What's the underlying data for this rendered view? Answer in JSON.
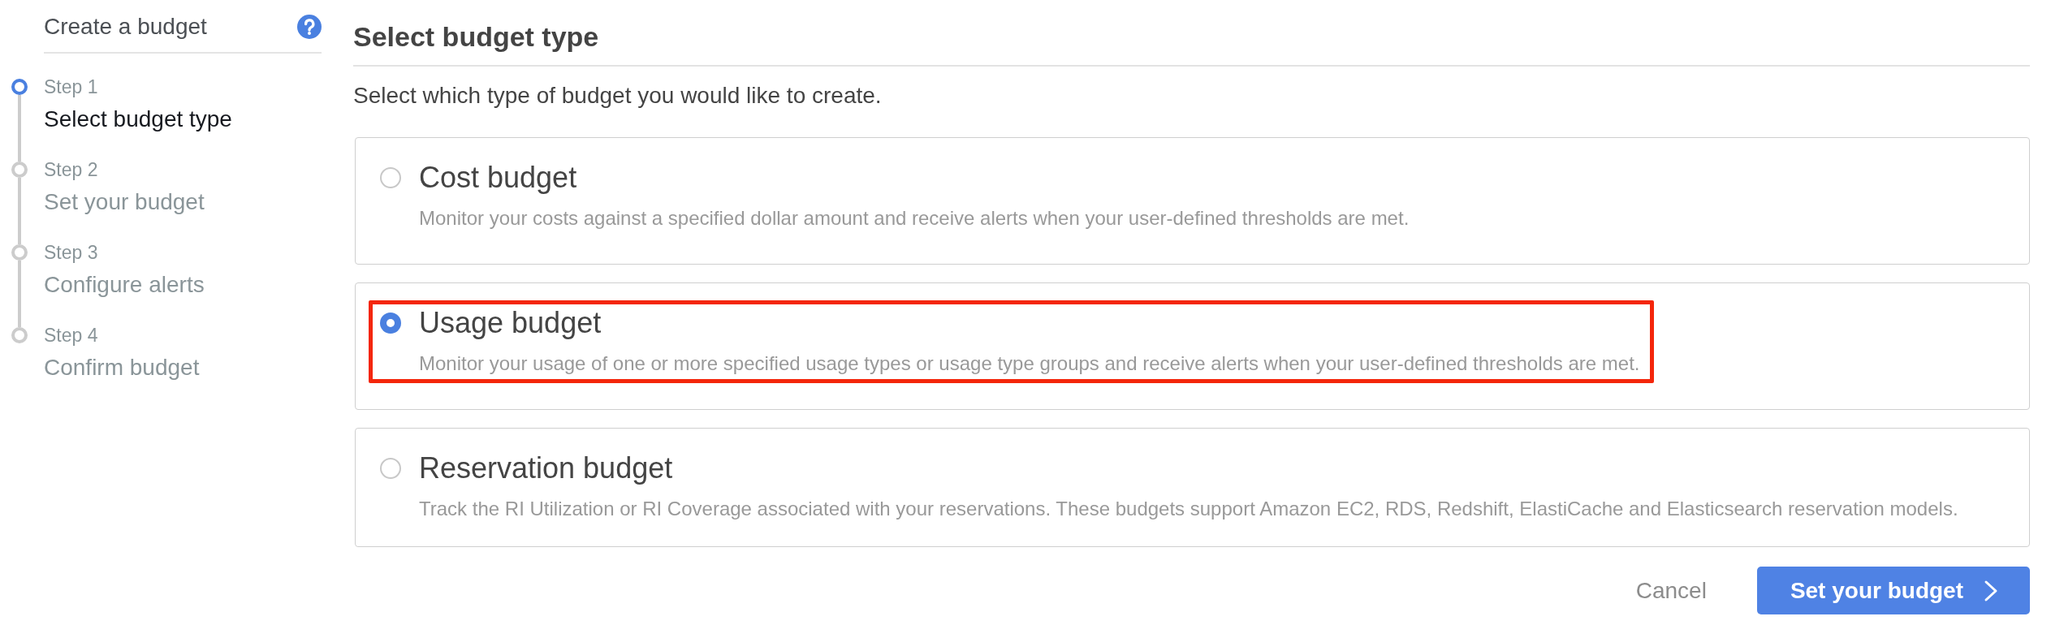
{
  "sidebar": {
    "title": "Create a budget",
    "steps": [
      {
        "label": "Step 1",
        "title": "Select budget type",
        "selected": true
      },
      {
        "label": "Step 2",
        "title": "Set your budget",
        "selected": false
      },
      {
        "label": "Step 3",
        "title": "Configure alerts",
        "selected": false
      },
      {
        "label": "Step 4",
        "title": "Confirm budget",
        "selected": false
      }
    ]
  },
  "main": {
    "heading": "Select budget type",
    "instruction": "Select which type of budget you would like to create.",
    "options": [
      {
        "title": "Cost budget",
        "description": "Monitor your costs against a specified dollar amount and receive alerts when your user-defined thresholds are met.",
        "selected": false,
        "highlighted": false
      },
      {
        "title": "Usage budget",
        "description": "Monitor your usage of one or more specified usage types or usage type groups and receive alerts when your user-defined thresholds are met.",
        "selected": true,
        "highlighted": true
      },
      {
        "title": "Reservation budget",
        "description": "Track the RI Utilization or RI Coverage associated with your reservations. These budgets support Amazon EC2, RDS, Redshift, ElastiCache and Elasticsearch reservation models.",
        "selected": false,
        "highlighted": false
      }
    ],
    "buttons": [
      {
        "label": "Cancel",
        "kind": "secondary"
      },
      {
        "label": "Set your budget",
        "kind": "primary"
      }
    ]
  }
}
